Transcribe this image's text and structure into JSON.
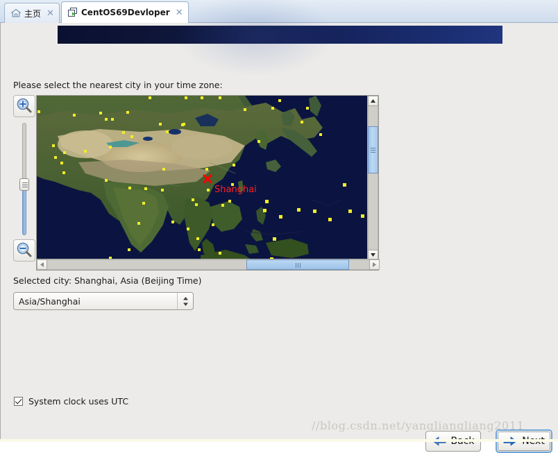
{
  "tabs": [
    {
      "label": "主页",
      "icon": "home-icon",
      "close": "✕",
      "active": false
    },
    {
      "label": "CentOS69Devloper",
      "icon": "virtual-machine-icon",
      "close": "✕",
      "active": true
    }
  ],
  "banner": {
    "color_left": "#0a1030",
    "color_right": "#20357f"
  },
  "prompt": "Please select the nearest city in your time zone:",
  "map": {
    "zoom_in_icon": "zoom-in-magnifier-icon",
    "zoom_out_icon": "zoom-out-magnifier-icon",
    "selected_marker_label": "Shanghai",
    "marker_color": "#ff0000",
    "city_dot_color": "#f2ee28",
    "ocean_color": "#0b1440",
    "scroll_up_icon": "▲",
    "scroll_down_icon": "▼",
    "scroll_left_icon": "❬",
    "scroll_right_icon": "❭"
  },
  "selected_city": "Selected city: Shanghai, Asia (Beijing Time)",
  "timezone_combo": {
    "value": "Asia/Shanghai",
    "up_arrow": "▲",
    "down_arrow": "▼"
  },
  "utc_checkbox": {
    "label": "System clock uses UTC",
    "checked": true
  },
  "buttons": {
    "back": "Back",
    "next": "Next",
    "back_icon": "arrow-left-icon",
    "next_icon": "arrow-right-icon"
  },
  "watermark": "//blog.csdn.net/yangliangliang2011"
}
